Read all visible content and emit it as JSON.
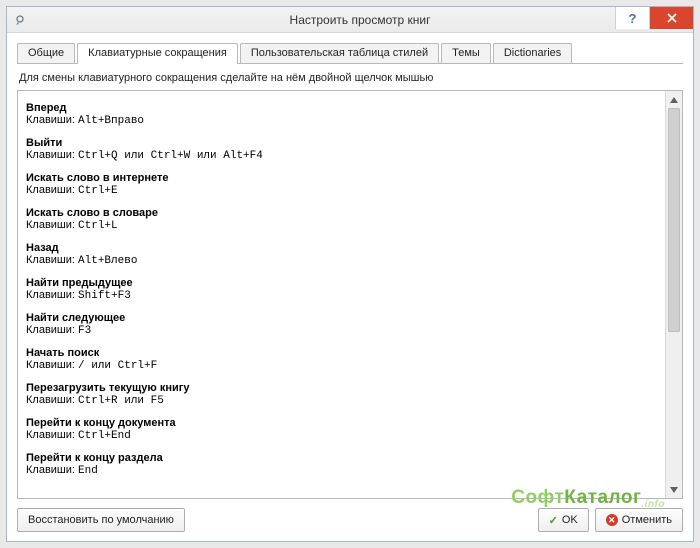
{
  "window": {
    "title": "Настроить просмотр книг"
  },
  "tabs": [
    {
      "label": "Общие",
      "active": false
    },
    {
      "label": "Клавиатурные сокращения",
      "active": true
    },
    {
      "label": "Пользовательская таблица стилей",
      "active": false
    },
    {
      "label": "Темы",
      "active": false
    },
    {
      "label": "Dictionaries",
      "active": false
    }
  ],
  "instruction": "Для смены клавиатурного сокращения сделайте на нём двойной щелчок мышью",
  "keys_label": "Клавиши:",
  "shortcuts": [
    {
      "name": "Вперед",
      "keys": "Alt+Вправо"
    },
    {
      "name": "Выйти",
      "keys": "Ctrl+Q или Ctrl+W или Alt+F4"
    },
    {
      "name": "Искать слово в интернете",
      "keys": "Ctrl+E"
    },
    {
      "name": "Искать слово в словаре",
      "keys": "Ctrl+L"
    },
    {
      "name": "Назад",
      "keys": "Alt+Влево"
    },
    {
      "name": "Найти предыдущее",
      "keys": "Shift+F3"
    },
    {
      "name": "Найти следующее",
      "keys": "F3"
    },
    {
      "name": "Начать поиск",
      "keys": "/ или Ctrl+F"
    },
    {
      "name": "Перезагрузить текущую книгу",
      "keys": "Ctrl+R или F5"
    },
    {
      "name": "Перейти к концу документа",
      "keys": "Ctrl+End"
    },
    {
      "name": "Перейти к концу раздела",
      "keys": "End"
    }
  ],
  "footer": {
    "restore_defaults": "Восстановить по умолчанию",
    "ok": "OK",
    "cancel": "Отменить"
  },
  "watermark": {
    "part1": "Софт",
    "part2": "Каталог",
    "suffix": ".info"
  }
}
